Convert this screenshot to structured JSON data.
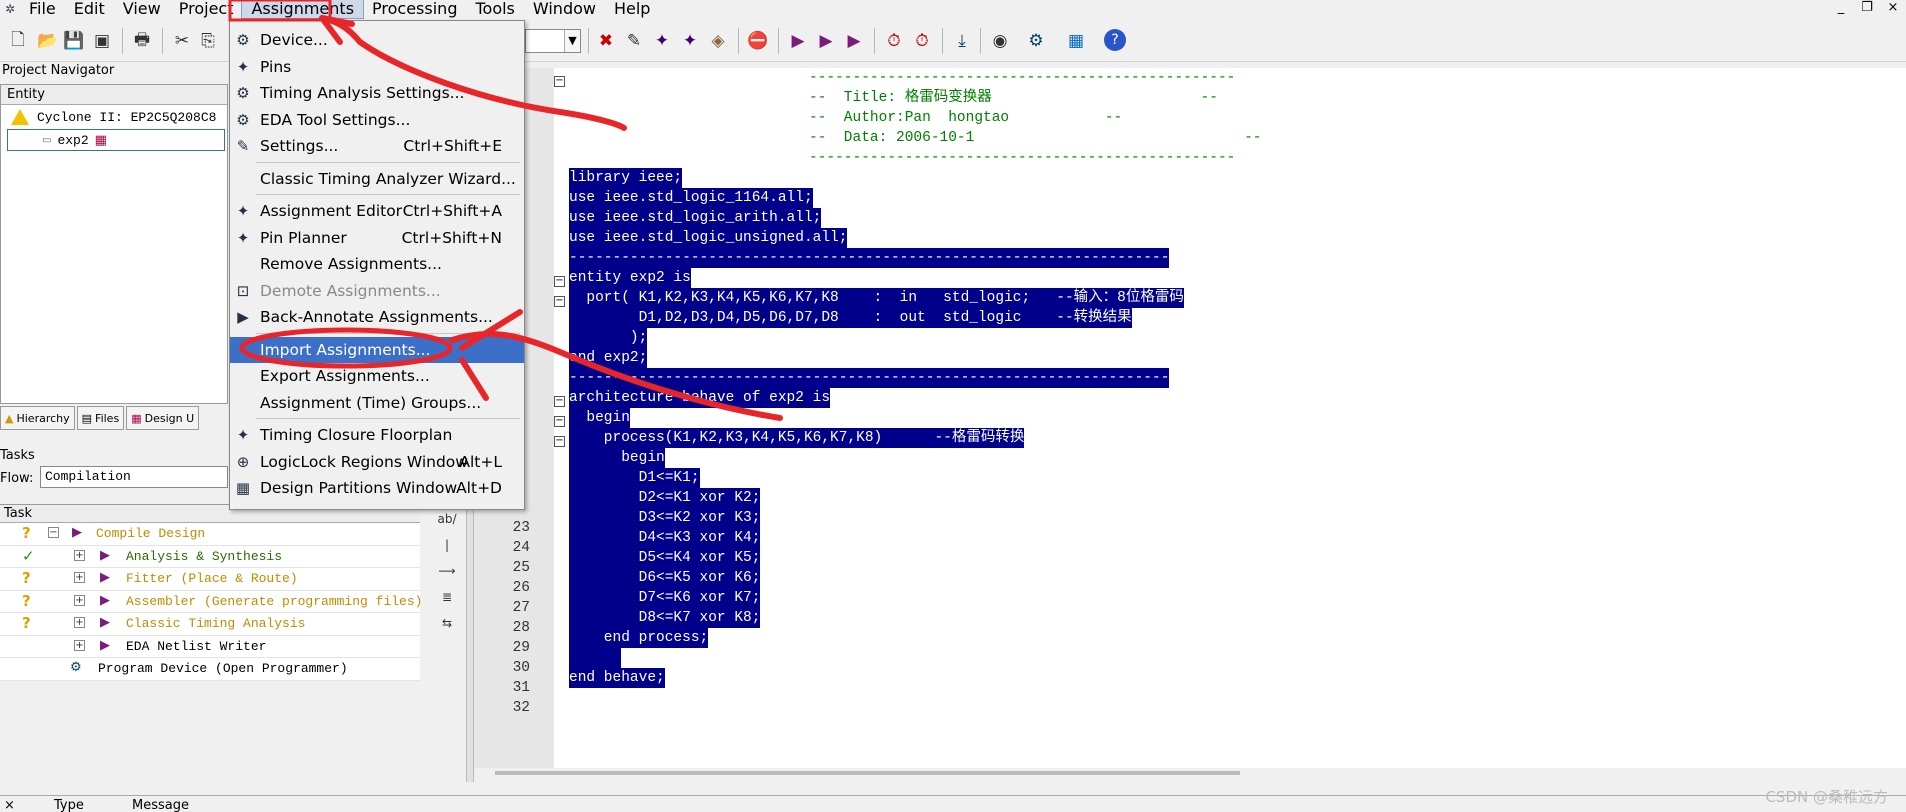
{
  "menubar": {
    "items": [
      "File",
      "Edit",
      "View",
      "Project",
      "Assignments",
      "Processing",
      "Tools",
      "Window",
      "Help"
    ],
    "active_item": "Assignments"
  },
  "window_controls": [
    "_",
    "❐",
    "×"
  ],
  "navigator": {
    "title": "Project Navigator",
    "column_header": "Entity",
    "device_row": "Cyclone II: EP2C5Q208C8",
    "entity_row": "exp2",
    "tabs": [
      "Hierarchy",
      "Files",
      "Design U"
    ]
  },
  "tasks": {
    "title": "Tasks",
    "flow_label": "Flow:",
    "flow_value": "Compilation",
    "column_header": "Task",
    "rows": [
      {
        "status": "?",
        "label": "Compile Design"
      },
      {
        "status": "✓",
        "label": "Analysis & Synthesis"
      },
      {
        "status": "?",
        "label": "Fitter (Place & Route)"
      },
      {
        "status": "?",
        "label": "Assembler (Generate programming files)"
      },
      {
        "status": "?",
        "label": "Classic Timing Analysis"
      },
      {
        "status": "",
        "label": "EDA Netlist Writer"
      },
      {
        "status": "",
        "label": "Program Device (Open Programmer)"
      }
    ]
  },
  "mini_toolbar": [
    "ab/",
    "|",
    "⟶",
    "≣",
    "⇆"
  ],
  "dropdown": {
    "items": [
      {
        "label": "Device...",
        "shortcut": "",
        "icon": "device-icon",
        "glyph": "⚙",
        "disabled": false
      },
      {
        "label": "Pins",
        "shortcut": "",
        "icon": "pins-icon",
        "glyph": "✦",
        "disabled": false
      },
      {
        "label": "Timing Analysis Settings...",
        "shortcut": "",
        "icon": "timing-icon",
        "glyph": "⚙",
        "disabled": false
      },
      {
        "label": "EDA Tool Settings...",
        "shortcut": "",
        "icon": "eda-icon",
        "glyph": "⚙",
        "disabled": false
      },
      {
        "label": "Settings...",
        "shortcut": "Ctrl+Shift+E",
        "icon": "settings-icon",
        "glyph": "✎",
        "disabled": false
      },
      {
        "label": "Classic Timing Analyzer Wizard...",
        "shortcut": "",
        "icon": "",
        "glyph": "",
        "disabled": false
      },
      {
        "label": "Assignment Editor",
        "shortcut": "Ctrl+Shift+A",
        "icon": "assignment-editor-icon",
        "glyph": "✦",
        "disabled": false
      },
      {
        "label": "Pin Planner",
        "shortcut": "Ctrl+Shift+N",
        "icon": "pin-planner-icon",
        "glyph": "✦",
        "disabled": false
      },
      {
        "label": "Remove Assignments...",
        "shortcut": "",
        "icon": "",
        "glyph": "",
        "disabled": false
      },
      {
        "label": "Demote Assignments...",
        "shortcut": "",
        "icon": "demote-icon",
        "glyph": "⊡",
        "disabled": true
      },
      {
        "label": "Back-Annotate Assignments...",
        "shortcut": "",
        "icon": "back-annotate-icon",
        "glyph": "▶",
        "disabled": false
      },
      {
        "label": "Import Assignments...",
        "shortcut": "",
        "icon": "",
        "glyph": "",
        "disabled": false
      },
      {
        "label": "Export Assignments...",
        "shortcut": "",
        "icon": "",
        "glyph": "",
        "disabled": false
      },
      {
        "label": "Assignment (Time) Groups...",
        "shortcut": "",
        "icon": "",
        "glyph": "",
        "disabled": false
      },
      {
        "label": "Timing Closure Floorplan",
        "shortcut": "",
        "icon": "floorplan-icon",
        "glyph": "✦",
        "disabled": false
      },
      {
        "label": "LogicLock Regions Window",
        "shortcut": "Alt+L",
        "icon": "logiclock-icon",
        "glyph": "⊕",
        "disabled": false
      },
      {
        "label": "Design Partitions Window",
        "shortcut": "Alt+D",
        "icon": "partitions-icon",
        "glyph": "▦",
        "disabled": false
      }
    ],
    "highlighted_index": 11
  },
  "editor": {
    "line_numbers": [
      "23",
      "24",
      "25",
      "26",
      "27",
      "28",
      "29",
      "30",
      "31",
      "32"
    ],
    "code": [
      {
        "text": "-------------------------------------------------",
        "sel": false,
        "comment": true,
        "indent": 240
      },
      {
        "text": "--  Title: 格雷码变换器                        --",
        "sel": false,
        "comment": true,
        "indent": 240
      },
      {
        "text": "--  Author:Pan  hongtao           --",
        "sel": false,
        "comment": true,
        "indent": 240
      },
      {
        "text": "--  Data: 2006-10-1                               --",
        "sel": false,
        "comment": true,
        "indent": 240
      },
      {
        "text": "-------------------------------------------------",
        "sel": false,
        "comment": true,
        "indent": 240
      },
      {
        "text": "library ieee;",
        "sel": true,
        "comment": false,
        "indent": 0
      },
      {
        "text": "use ieee.std_logic_1164.all;",
        "sel": true,
        "comment": false,
        "indent": 0
      },
      {
        "text": "use ieee.std_logic_arith.all;",
        "sel": true,
        "comment": false,
        "indent": 0
      },
      {
        "text": "use ieee.std_logic_unsigned.all;",
        "sel": true,
        "comment": false,
        "indent": 0
      },
      {
        "text": "---------------------------------------------------------------------",
        "sel": true,
        "comment": false,
        "indent": 0
      },
      {
        "text": "entity exp2 is",
        "sel": true,
        "comment": false,
        "indent": 0
      },
      {
        "text": "  port( K1,K2,K3,K4,K5,K6,K7,K8    :  in   std_logic;   --输入：8位格雷码",
        "sel": true,
        "comment": false,
        "indent": 0
      },
      {
        "text": "        D1,D2,D3,D4,D5,D6,D7,D8    :  out  std_logic    --转换结果",
        "sel": true,
        "comment": false,
        "indent": 0
      },
      {
        "text": "       );",
        "sel": true,
        "comment": false,
        "indent": 0
      },
      {
        "text": "end exp2;",
        "sel": true,
        "comment": false,
        "indent": 0
      },
      {
        "text": "---------------------------------------------------------------------",
        "sel": true,
        "comment": false,
        "indent": 0
      },
      {
        "text": "architecture behave of exp2 is",
        "sel": true,
        "comment": false,
        "indent": 0
      },
      {
        "text": "  begin",
        "sel": true,
        "comment": false,
        "indent": 0
      },
      {
        "text": "    process(K1,K2,K3,K4,K5,K6,K7,K8)      --格雷码转换",
        "sel": true,
        "comment": false,
        "indent": 0
      },
      {
        "text": "      begin",
        "sel": true,
        "comment": false,
        "indent": 0
      },
      {
        "text": "        D1<=K1;",
        "sel": true,
        "comment": false,
        "indent": 0
      },
      {
        "text": "        D2<=K1 xor K2;",
        "sel": true,
        "comment": false,
        "indent": 0
      },
      {
        "text": "        D3<=K2 xor K3;",
        "sel": true,
        "comment": false,
        "indent": 0
      },
      {
        "text": "        D4<=K3 xor K4;",
        "sel": true,
        "comment": false,
        "indent": 0
      },
      {
        "text": "        D5<=K4 xor K5;",
        "sel": true,
        "comment": false,
        "indent": 0
      },
      {
        "text": "        D6<=K5 xor K6;",
        "sel": true,
        "comment": false,
        "indent": 0
      },
      {
        "text": "        D7<=K6 xor K7;",
        "sel": true,
        "comment": false,
        "indent": 0
      },
      {
        "text": "        D8<=K7 xor K8;",
        "sel": true,
        "comment": false,
        "indent": 0
      },
      {
        "text": "    end process;",
        "sel": true,
        "comment": false,
        "indent": 0
      },
      {
        "text": "      ",
        "sel": true,
        "comment": false,
        "indent": 0
      },
      {
        "text": "end behave;",
        "sel": true,
        "comment": false,
        "indent": 0
      },
      {
        "text": "",
        "sel": false,
        "comment": false,
        "indent": 0
      }
    ]
  },
  "bottom": {
    "close": "×",
    "type_label": "Type",
    "message_label": "Message"
  },
  "watermark": "CSDN @桑稚远方",
  "colors": {
    "selection": "#00008b",
    "highlight": "#3c6fc8",
    "annotation": "#e8262a"
  }
}
